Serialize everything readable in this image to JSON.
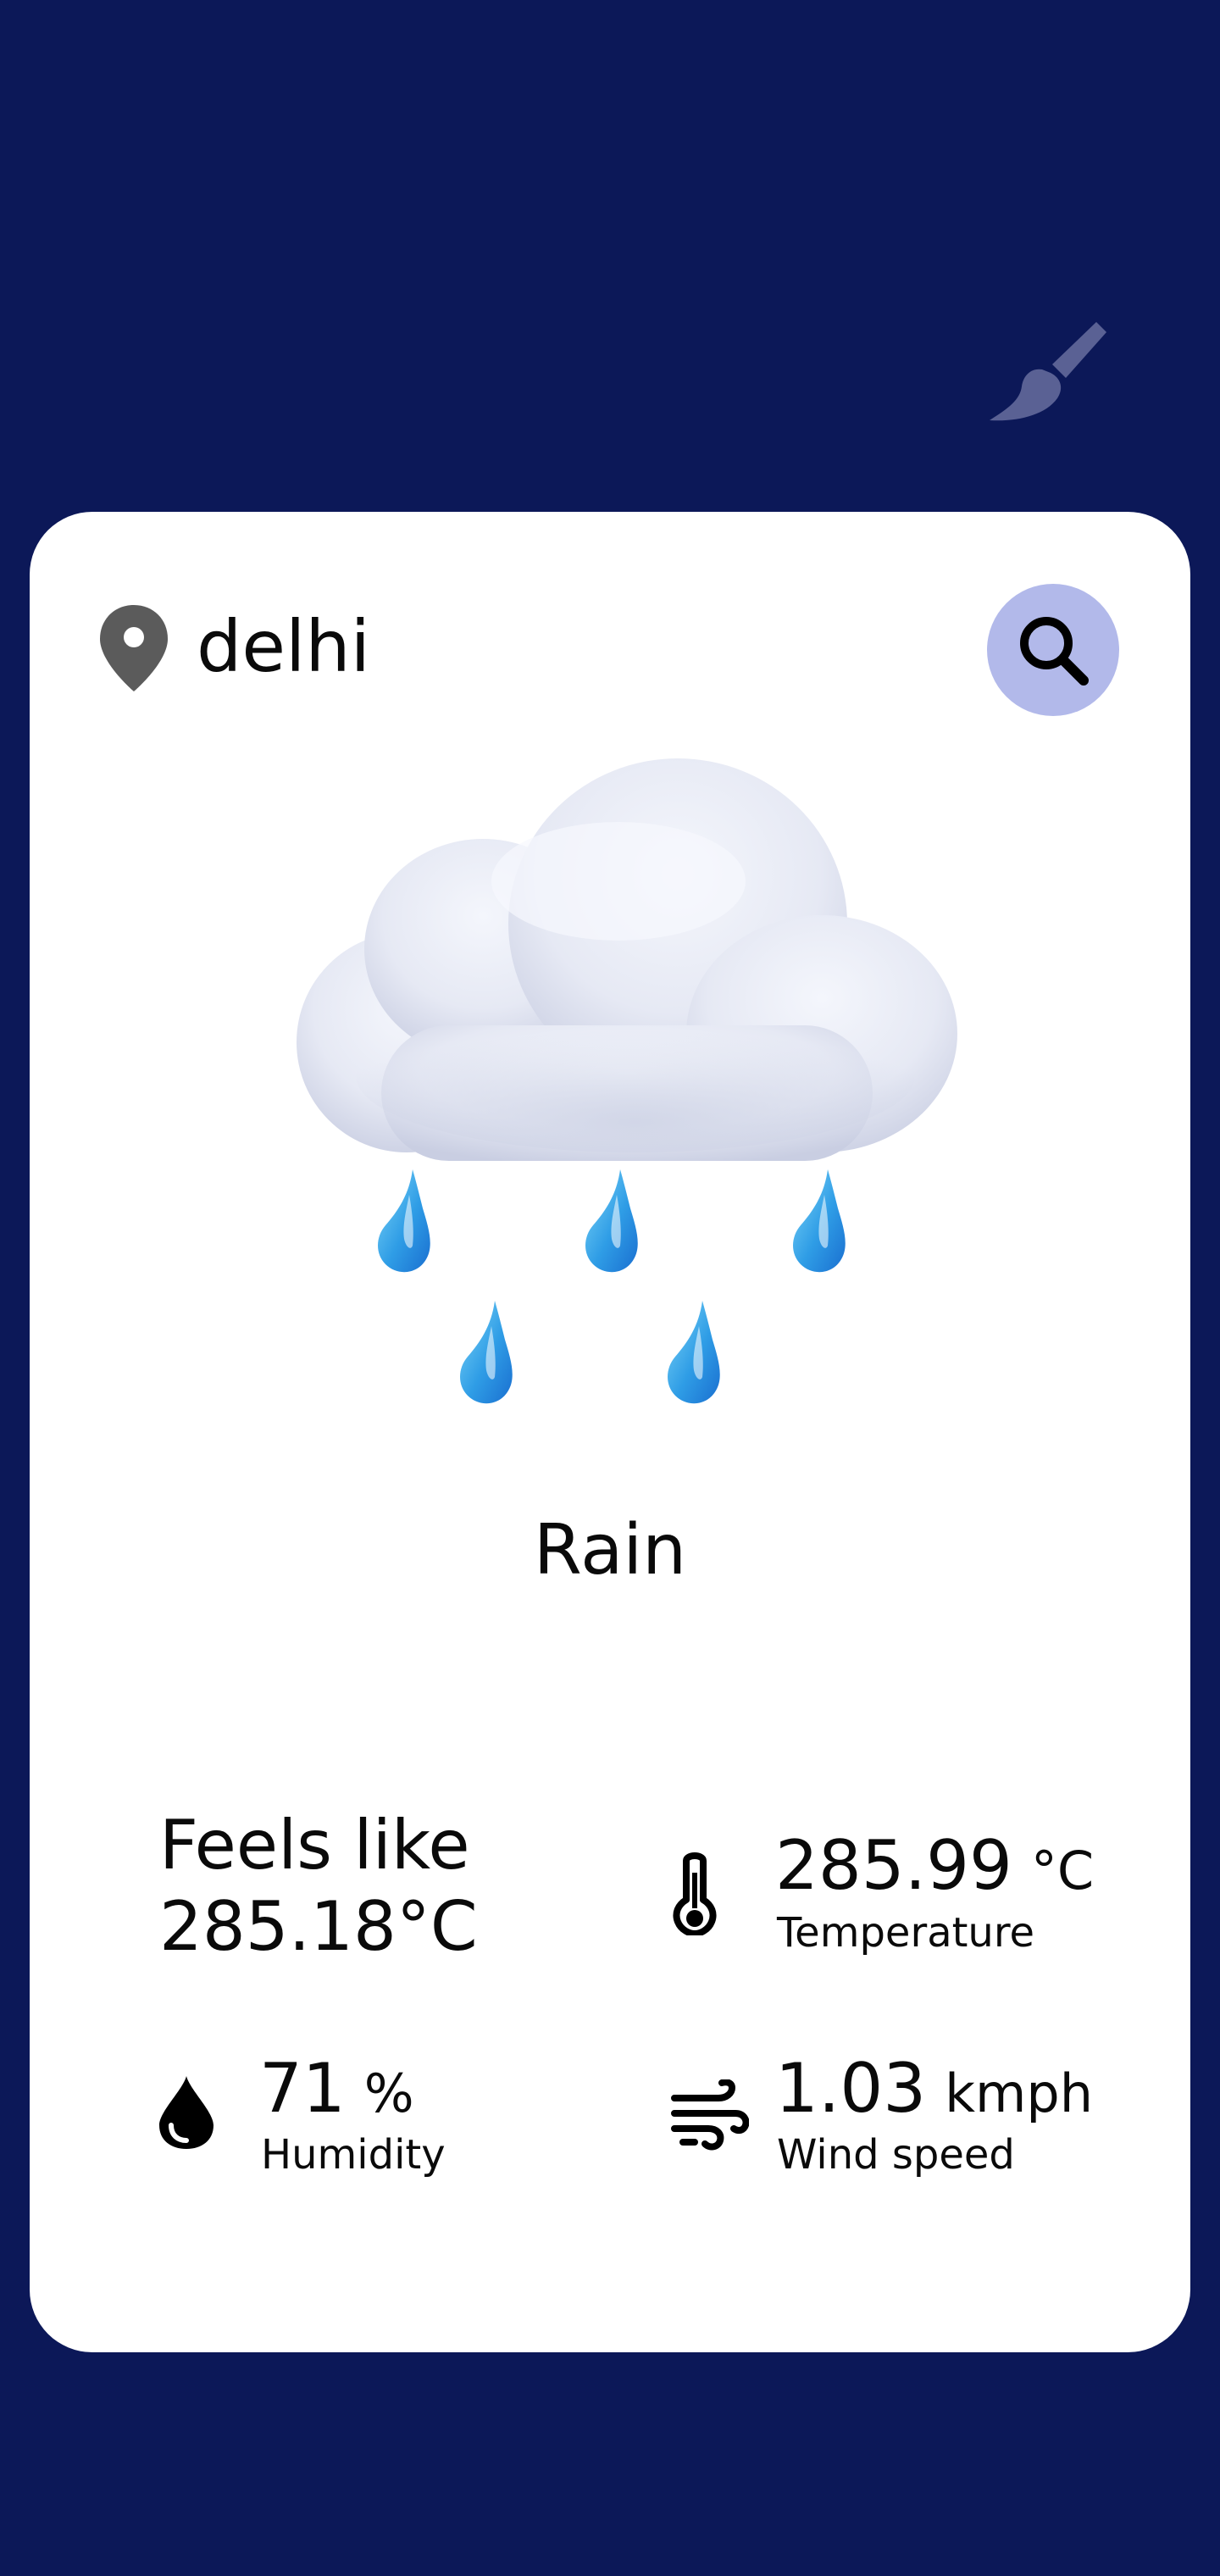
{
  "app": {
    "theme_toggle_icon": "paintbrush-icon",
    "background_color": "#0c1858",
    "card_color": "#ffffff",
    "search_button_color": "#b2b9ea"
  },
  "header": {
    "location_icon": "map-pin-icon",
    "city": "delhi",
    "search_icon": "search-icon"
  },
  "weather": {
    "illustration": "rain-cloud-icon",
    "condition": "Rain",
    "feels_like_label": "Feels like",
    "feels_like_value": "285.18°C"
  },
  "stats": {
    "temperature": {
      "icon": "thermometer-icon",
      "value": "285.99",
      "unit": "°C",
      "label": "Temperature"
    },
    "humidity": {
      "icon": "droplet-icon",
      "value": "71",
      "unit": "%",
      "label": "Humidity"
    },
    "wind": {
      "icon": "wind-icon",
      "value": "1.03",
      "unit": "kmph",
      "label": "Wind speed"
    }
  }
}
